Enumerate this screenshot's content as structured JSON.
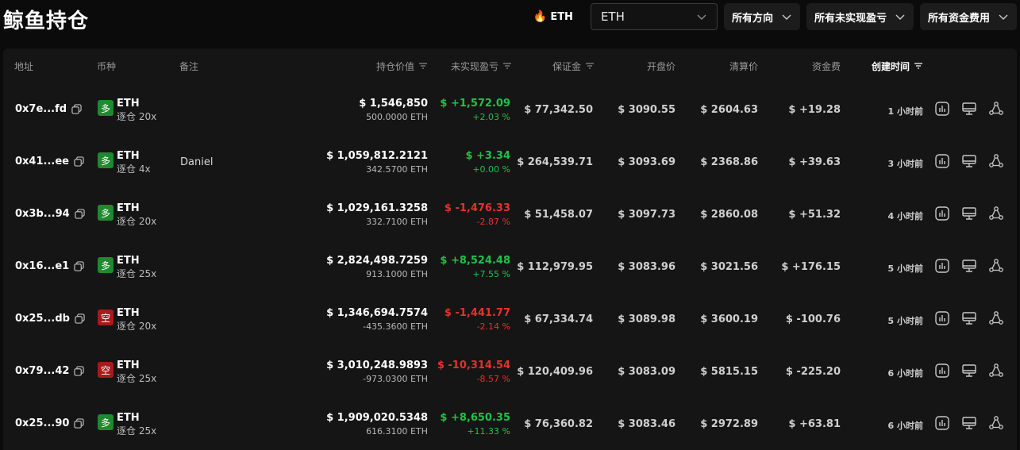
{
  "page": {
    "title": "鲸鱼持仓",
    "coin_tag": "ETH",
    "coin_select_value": "ETH",
    "filters": [
      "所有方向",
      "所有未实现盈亏",
      "所有资金费用"
    ]
  },
  "colors": {
    "profit": "#1fc24a",
    "loss": "#e5322d",
    "long_badge": "#1d8a2e",
    "short_badge": "#a81b1b"
  },
  "columns": {
    "address": "地址",
    "coin": "币种",
    "note": "备注",
    "value": "持仓价值",
    "pnl": "未实现盈亏",
    "margin": "保证金",
    "open": "开盘价",
    "liq": "清算价",
    "funding": "资金费",
    "created": "创建时间"
  },
  "rows": [
    {
      "address": "0x7e...fd",
      "side": "多",
      "side_type": "long",
      "coin": "ETH",
      "leverage": "逐仓 20x",
      "note": "",
      "value": "$ 1,546,850",
      "size": "500.0000 ETH",
      "pnl": "$ +1,572.09",
      "pnl_pct": "+2.03 %",
      "pnl_sign": "pos",
      "margin": "$ 77,342.50",
      "open": "$ 3090.55",
      "liq": "$ 2604.63",
      "funding": "$ +19.28",
      "funding_sign": "pos",
      "time": "1 小时前"
    },
    {
      "address": "0x41...ee",
      "side": "多",
      "side_type": "long",
      "coin": "ETH",
      "leverage": "逐仓 4x",
      "note": "Daniel",
      "value": "$ 1,059,812.2121",
      "size": "342.5700 ETH",
      "pnl": "$ +3.34",
      "pnl_pct": "+0.00 %",
      "pnl_sign": "pos",
      "margin": "$ 264,539.71",
      "open": "$ 3093.69",
      "liq": "$ 2368.86",
      "funding": "$ +39.63",
      "funding_sign": "pos",
      "time": "3 小时前"
    },
    {
      "address": "0x3b...94",
      "side": "多",
      "side_type": "long",
      "coin": "ETH",
      "leverage": "逐仓 20x",
      "note": "",
      "value": "$ 1,029,161.3258",
      "size": "332.7100 ETH",
      "pnl": "$ -1,476.33",
      "pnl_pct": "-2.87 %",
      "pnl_sign": "neg",
      "margin": "$ 51,458.07",
      "open": "$ 3097.73",
      "liq": "$ 2860.08",
      "funding": "$ +51.32",
      "funding_sign": "pos",
      "time": "4 小时前"
    },
    {
      "address": "0x16...e1",
      "side": "多",
      "side_type": "long",
      "coin": "ETH",
      "leverage": "逐仓 25x",
      "note": "",
      "value": "$ 2,824,498.7259",
      "size": "913.1000 ETH",
      "pnl": "$ +8,524.48",
      "pnl_pct": "+7.55 %",
      "pnl_sign": "pos",
      "margin": "$ 112,979.95",
      "open": "$ 3083.96",
      "liq": "$ 3021.56",
      "funding": "$ +176.15",
      "funding_sign": "pos",
      "time": "5 小时前"
    },
    {
      "address": "0x25...db",
      "side": "空",
      "side_type": "short",
      "coin": "ETH",
      "leverage": "逐仓 20x",
      "note": "",
      "value": "$ 1,346,694.7574",
      "size": "-435.3600 ETH",
      "pnl": "$ -1,441.77",
      "pnl_pct": "-2.14 %",
      "pnl_sign": "neg",
      "margin": "$ 67,334.74",
      "open": "$ 3089.98",
      "liq": "$ 3600.19",
      "funding": "$ -100.76",
      "funding_sign": "neg",
      "time": "5 小时前"
    },
    {
      "address": "0x79...42",
      "side": "空",
      "side_type": "short",
      "coin": "ETH",
      "leverage": "逐仓 25x",
      "note": "",
      "value": "$ 3,010,248.9893",
      "size": "-973.0300 ETH",
      "pnl": "$ -10,314.54",
      "pnl_pct": "-8.57 %",
      "pnl_sign": "neg",
      "margin": "$ 120,409.96",
      "open": "$ 3083.09",
      "liq": "$ 5815.15",
      "funding": "$ -225.20",
      "funding_sign": "neg",
      "time": "6 小时前"
    },
    {
      "address": "0x25...90",
      "side": "多",
      "side_type": "long",
      "coin": "ETH",
      "leverage": "逐仓 25x",
      "note": "",
      "value": "$ 1,909,020.5348",
      "size": "616.3100 ETH",
      "pnl": "$ +8,650.35",
      "pnl_pct": "+11.33 %",
      "pnl_sign": "pos",
      "margin": "$ 76,360.82",
      "open": "$ 3083.46",
      "liq": "$ 2972.89",
      "funding": "$ +63.81",
      "funding_sign": "pos",
      "time": "6 小时前"
    }
  ]
}
